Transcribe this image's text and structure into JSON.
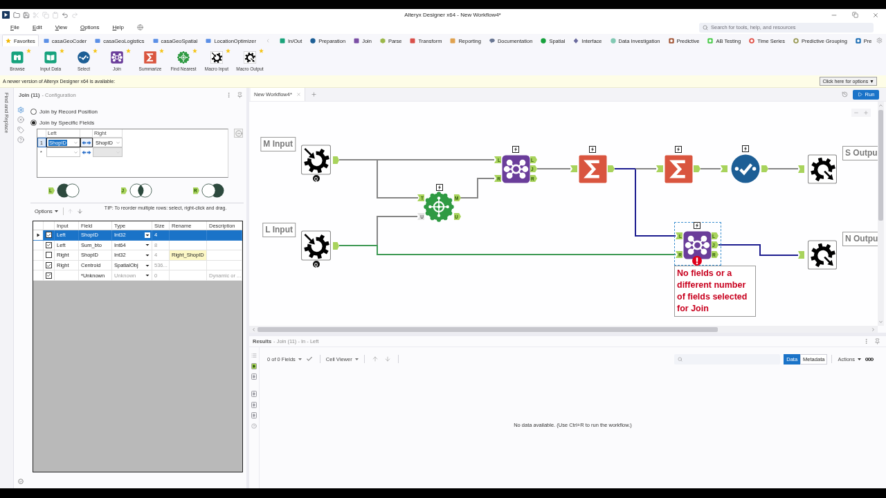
{
  "title_bar": {
    "title": "Alteryx Designer x64 - New Workflow4*",
    "quick_tools": [
      {
        "kind": "open",
        "disabled": false
      },
      {
        "kind": "save",
        "disabled": false
      },
      {
        "kind": "cut",
        "disabled": true
      },
      {
        "kind": "copy",
        "disabled": true
      },
      {
        "kind": "paste",
        "disabled": true
      },
      {
        "kind": "undo",
        "disabled": false
      },
      {
        "kind": "redo",
        "disabled": true
      }
    ]
  },
  "menu": [
    {
      "label": "File"
    },
    {
      "label": "Edit"
    },
    {
      "label": "View"
    },
    {
      "label": "Options"
    },
    {
      "label": "Help"
    }
  ],
  "search": {
    "placeholder": "Search for tools, help, and resources"
  },
  "favorites_tabs": [
    {
      "label": "Favorites",
      "kind": "star",
      "color": "#f2b705",
      "selected": true
    },
    {
      "label": "casaGeoCoder",
      "kind": "folder",
      "color": "#5b8fe6",
      "selected": false
    },
    {
      "label": "casaGeoLogistics",
      "kind": "folder",
      "color": "#5b8fe6",
      "selected": false
    },
    {
      "label": "casaGeoSpatial",
      "kind": "folder",
      "color": "#5b8fe6",
      "selected": false
    },
    {
      "label": "LocationOptimizer",
      "kind": "folder",
      "color": "#5b8fe6",
      "selected": false
    }
  ],
  "category_tabs": [
    {
      "label": "In/Out",
      "kind": "square",
      "color": "#1aa37a",
      "selected": false
    },
    {
      "label": "Preparation",
      "kind": "circle",
      "color": "#1d5f96",
      "selected": false
    },
    {
      "label": "Join",
      "kind": "square",
      "color": "#7b4fa5",
      "selected": false
    },
    {
      "label": "Parse",
      "kind": "hexagon",
      "color": "#9cb84a",
      "selected": false
    },
    {
      "label": "Transform",
      "kind": "square",
      "color": "#d9504a",
      "selected": false
    },
    {
      "label": "Reporting",
      "kind": "square",
      "color": "#e0a24f",
      "selected": false
    },
    {
      "label": "Documentation",
      "kind": "bubble",
      "color": "#6b7894",
      "selected": false
    },
    {
      "label": "Spatial",
      "kind": "circle",
      "color": "#17a13c",
      "selected": false
    },
    {
      "label": "Interface",
      "kind": "diamond",
      "color": "#6a6a9e",
      "selected": false
    },
    {
      "label": "Data Investigation",
      "kind": "circle",
      "color": "#82c9b3",
      "selected": false
    },
    {
      "label": "Predictive",
      "kind": "ring_square",
      "color": "#a3583a",
      "selected": false
    },
    {
      "label": "AB Testing",
      "kind": "ring_square",
      "color": "#4ccb4c",
      "selected": false
    },
    {
      "label": "Time Series",
      "kind": "ring",
      "color": "#e05046",
      "selected": false
    },
    {
      "label": "Predictive Grouping",
      "kind": "ring",
      "color": "#9a9a58",
      "selected": false
    },
    {
      "label": "Pre",
      "kind": "ring_square",
      "color": "#1f6fb5",
      "selected": false
    }
  ],
  "tool_palette": [
    {
      "label": "Browse",
      "kind": "browse",
      "favorite": true
    },
    {
      "label": "Input Data",
      "kind": "input",
      "favorite": true
    },
    {
      "label": "Select",
      "kind": "select",
      "favorite": true
    },
    {
      "label": "Join",
      "kind": "join",
      "favorite": true
    },
    {
      "label": "Summarize",
      "kind": "summarize",
      "favorite": true
    },
    {
      "label": "Find Nearest",
      "kind": "find_nearest",
      "favorite": true
    },
    {
      "label": "Macro Input",
      "kind": "macro_input",
      "favorite": true
    },
    {
      "label": "Macro Output",
      "kind": "macro_output",
      "favorite": true
    }
  ],
  "notification": {
    "message": "A newer version of Alteryx Designer x64 is available:",
    "button": "Click here for options ▼"
  },
  "side_strip": {
    "label": "Find and Replace"
  },
  "config": {
    "title": "Join (11)",
    "subtitle": "- Configuration",
    "side_tabs": [
      {
        "kind": "settings",
        "selected": true
      },
      {
        "kind": "cross",
        "selected": false
      },
      {
        "kind": "tag",
        "selected": false
      },
      {
        "kind": "help",
        "selected": false
      }
    ],
    "join_modes": [
      {
        "label": "Join by Record Position",
        "selected": false
      },
      {
        "label": "Join by Specific Fields",
        "selected": true
      }
    ],
    "join_fields": {
      "columns": [
        "Left",
        "Right"
      ],
      "rows": [
        {
          "number": "1",
          "left": "ShopID",
          "right": "ShopID",
          "selected": true,
          "disabled": false
        },
        {
          "number": "*",
          "selected": false,
          "disabled": true
        }
      ]
    },
    "join_outputs": [
      {
        "anchor": "L",
        "kind": "left"
      },
      {
        "anchor": "J",
        "kind": "inner"
      },
      {
        "anchor": "R",
        "kind": "right"
      }
    ],
    "options_label": "Options",
    "reorder": [
      {
        "kind": "up",
        "disabled": true
      },
      {
        "kind": "down",
        "disabled": false
      }
    ],
    "tip": "TIP: To reorder multiple rows: select, right-click and drag.",
    "fields": {
      "columns": [
        "Input",
        "Field",
        "Type",
        "Size",
        "Rename",
        "Description"
      ],
      "rows": [
        {
          "kind": "field",
          "selected": true,
          "checked": true,
          "input": "Left",
          "field": "ShopID",
          "type": "Int32",
          "size": "4"
        },
        {
          "kind": "field",
          "selected": false,
          "checked": true,
          "input": "Left",
          "field": "Sum_bto",
          "type": "Int64",
          "size": "8"
        },
        {
          "kind": "field",
          "selected": false,
          "checked": false,
          "input": "Right",
          "field": "ShopID",
          "type": "Int32",
          "size": "4",
          "rename": "Right_ShopID"
        },
        {
          "kind": "field",
          "selected": false,
          "checked": true,
          "input": "Right",
          "field": "Centroid",
          "type": "SpatialObj",
          "size": "536..."
        },
        {
          "kind": "dynamic",
          "selected": false,
          "checked": true,
          "field": "*Unknown",
          "type": "Unknown",
          "size": "0",
          "description": "Dynamic or ..."
        }
      ]
    }
  },
  "canvas": {
    "tabs": [
      {
        "label": "New Workflow4*",
        "selected": true
      }
    ],
    "run": "Run",
    "nodes": [
      {
        "kind": "macro_input",
        "label": "M Input",
        "badge": "Q",
        "lightning": false,
        "selected": false,
        "error": false
      },
      {
        "kind": "macro_input",
        "label": "L Input",
        "badge": "Q",
        "lightning": false,
        "selected": false,
        "error": false
      },
      {
        "kind": "find_nearest",
        "inputs": [
          {
            "label": "T",
            "optional": false
          },
          {
            "label": "U",
            "optional": true
          }
        ],
        "outputs": [
          {
            "label": "M",
            "optional": false
          },
          {
            "label": "U",
            "optional": false
          }
        ],
        "lightning": true,
        "selected": false,
        "error": false
      },
      {
        "kind": "join",
        "inputs": [
          {
            "label": "L",
            "optional": false
          },
          {
            "label": "R",
            "optional": false
          }
        ],
        "outputs": [
          {
            "label": "L",
            "optional": false
          },
          {
            "label": "J",
            "optional": false
          },
          {
            "label": "R",
            "optional": false
          }
        ],
        "lightning": true,
        "selected": false,
        "error": false
      },
      {
        "kind": "summarize",
        "lightning": true,
        "selected": false,
        "error": false
      },
      {
        "kind": "summarize",
        "lightning": true,
        "selected": false,
        "error": false
      },
      {
        "kind": "select",
        "lightning": true,
        "selected": false,
        "error": false
      },
      {
        "kind": "macro_output",
        "label": "S Outpu",
        "lightning": false,
        "selected": false,
        "error": false
      },
      {
        "kind": "join",
        "inputs": [
          {
            "label": "L",
            "optional": false
          },
          {
            "label": "R",
            "optional": false
          }
        ],
        "outputs": [
          {
            "label": "L",
            "optional": false
          },
          {
            "label": "J",
            "optional": false
          },
          {
            "label": "R",
            "optional": false
          }
        ],
        "lightning": true,
        "selected": true,
        "error": true,
        "annotation": "No fields or a different number of fields selected for Join"
      },
      {
        "kind": "macro_output",
        "label": "N Outpu",
        "lightning": false,
        "selected": false,
        "error": false
      }
    ],
    "connections": [
      {
        "color": "#858585"
      },
      {
        "color": "#858585"
      },
      {
        "color": "#858585"
      },
      {
        "color": "#3f9a55"
      },
      {
        "color": "#858585"
      },
      {
        "color": "#858585"
      },
      {
        "color": "#1c1c8f"
      },
      {
        "color": "#858585"
      },
      {
        "color": "#858585"
      },
      {
        "color": "#858585"
      },
      {
        "color": "#1c1c8f"
      }
    ]
  },
  "results": {
    "title": "Results",
    "subtitle": "- Join (11) - In - Left",
    "side_tabs": [
      {
        "kind": "list",
        "selected": false
      },
      {
        "kind": "anchor",
        "selected": true
      },
      {
        "kind": "anchor",
        "selected": false
      },
      {
        "kind": "anchor",
        "selected": false
      },
      {
        "kind": "anchor",
        "selected": false
      },
      {
        "kind": "anchor",
        "selected": false
      },
      {
        "kind": "help",
        "selected": false
      }
    ],
    "fields_menu": "0 of 0 Fields",
    "cell_viewer": "Cell Viewer",
    "views": [
      {
        "label": "Data",
        "selected": true
      },
      {
        "label": "Metadata",
        "selected": false
      }
    ],
    "actions": "Actions",
    "empty_message": "No data available. (Use Ctrl+R to run the workflow.)"
  }
}
